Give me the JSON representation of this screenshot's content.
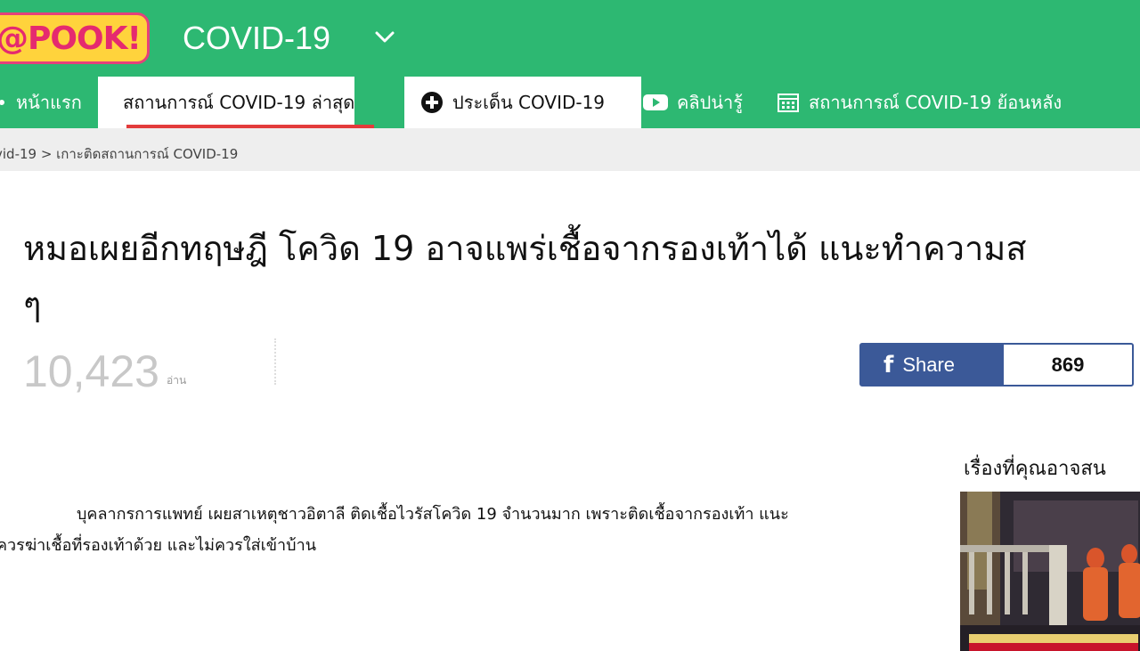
{
  "header": {
    "logo_text": "@POOK!",
    "section_title": "COVID-19"
  },
  "nav": {
    "items": [
      {
        "label": "หน้าแรก",
        "icon": "home-icon"
      },
      {
        "label": "สถานการณ์ COVID-19 ล่าสุด",
        "icon": "heartbeat-icon",
        "active": true
      },
      {
        "label": "ประเด็น COVID-19",
        "icon": "plus-circle-icon"
      },
      {
        "label": "คลิปน่ารู้",
        "icon": "youtube-icon"
      },
      {
        "label": "สถานการณ์ COVID-19 ย้อนหลัง",
        "icon": "calendar-icon"
      }
    ]
  },
  "breadcrumb": {
    "text": "vid-19 > เกาะติดสถานการณ์ COVID-19"
  },
  "article": {
    "title_line1": "หมอเผยอีกทฤษฎี โควิด 19 อาจแพร่เชื้อจากรองเท้าได้ แนะทำความส",
    "title_line2": "ๆ",
    "views": "10,423",
    "views_unit": "อ่าน",
    "body_line1": "บุคลากรการแพทย์ เผยสาเหตุชาวอิตาลี ติดเชื้อไวรัสโควิด 19 จำนวนมาก เพราะติดเชื้อจากรองเท้า แนะ",
    "body_line2": "ควรฆ่าเชื้อที่รองเท้าด้วย และไม่ควรใส่เข้าบ้าน"
  },
  "share": {
    "label": "Share",
    "count": "869"
  },
  "related": {
    "title": "เรื่องที่คุณอาจสน"
  },
  "colors": {
    "brand_green": "#2db872",
    "active_underline": "#e33b3b",
    "facebook_blue": "#3b5998"
  }
}
